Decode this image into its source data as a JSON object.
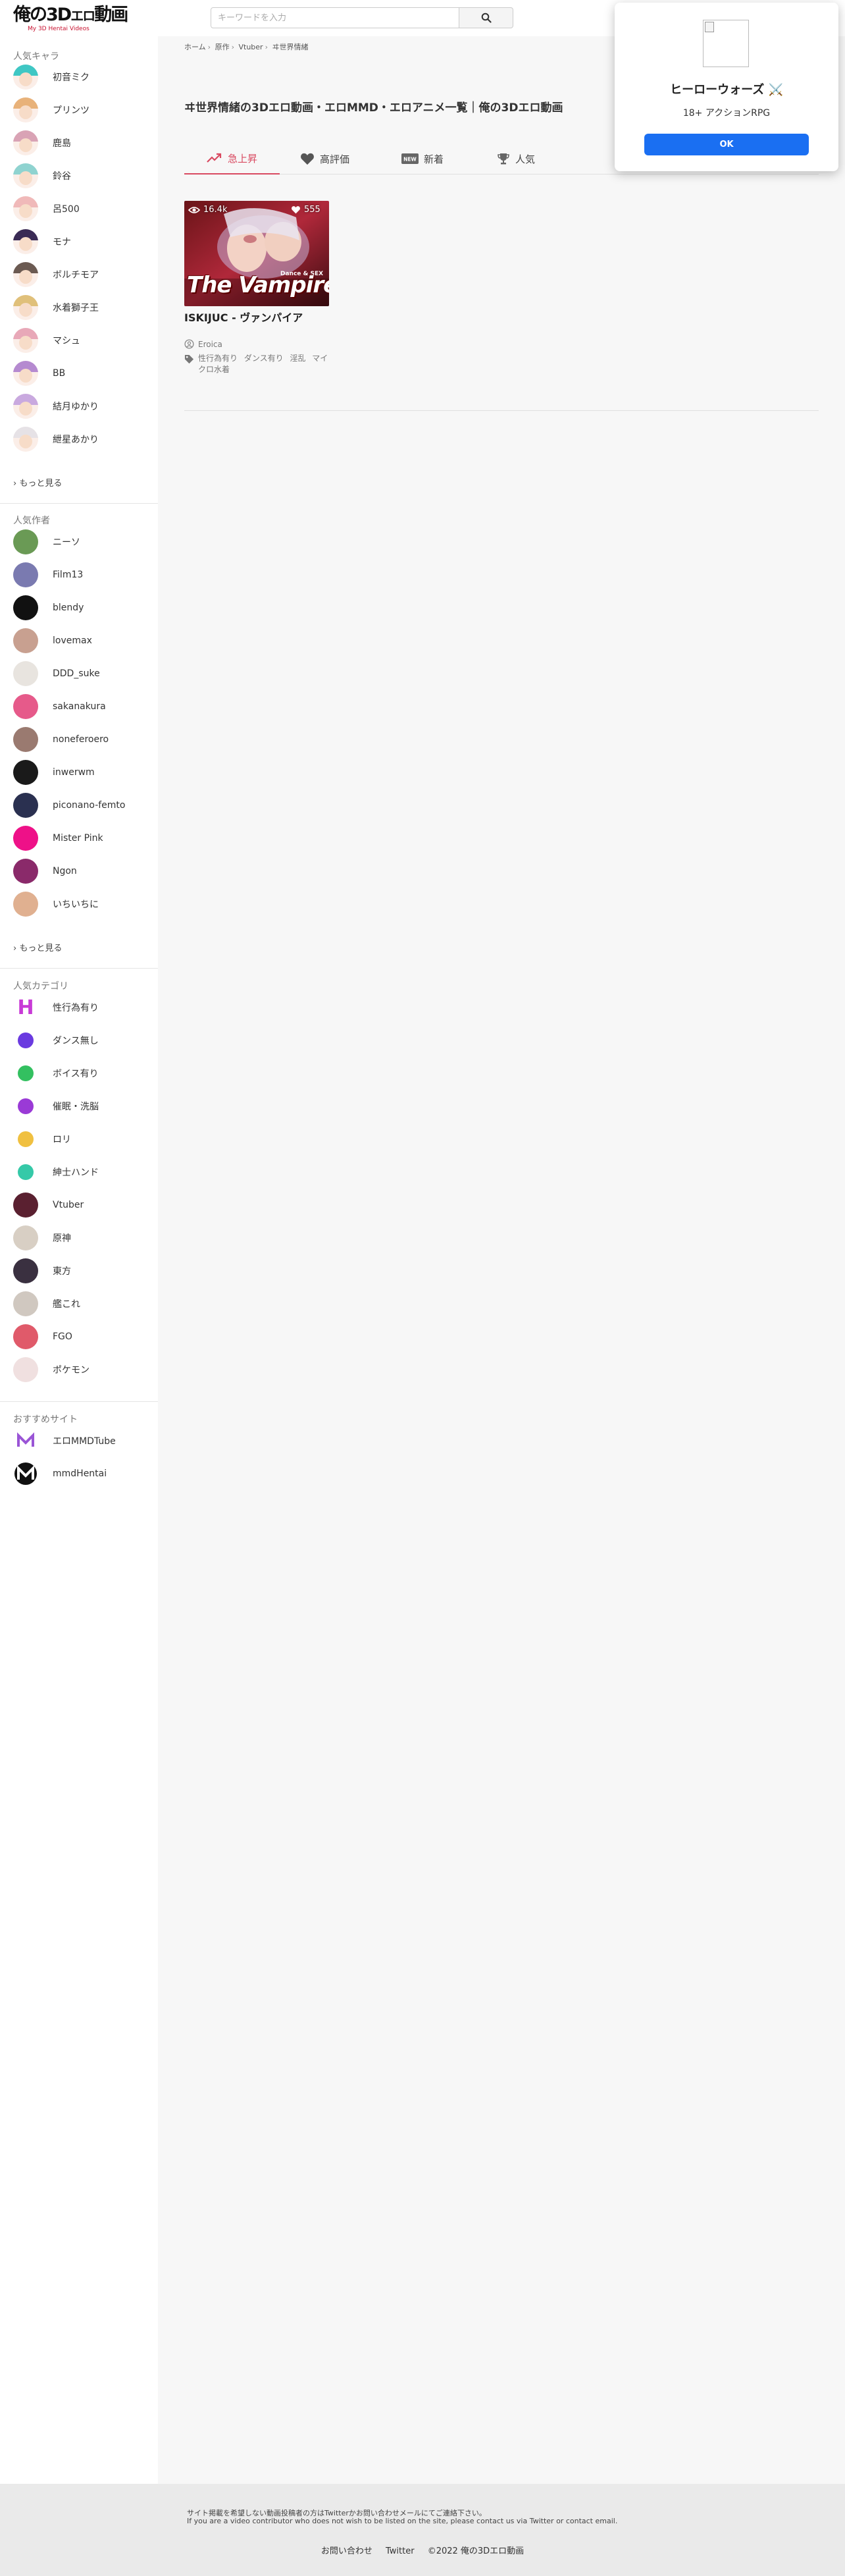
{
  "header": {
    "logo_main": "俺の3D",
    "logo_small": "エロ",
    "logo_tail": "動画",
    "logo_sub": "My 3D Hentai Videos",
    "search_placeholder": "キーワードを入力",
    "search_value": ""
  },
  "sidebar": {
    "characters_title": "人気キャラ",
    "characters": [
      {
        "label": "初音ミク",
        "hair": "#3fc7c4"
      },
      {
        "label": "プリンツ",
        "hair": "#e8b27a"
      },
      {
        "label": "鹿島",
        "hair": "#d9a3b5"
      },
      {
        "label": "鈴谷",
        "hair": "#8fd3d0"
      },
      {
        "label": "呂500",
        "hair": "#f0b9b9"
      },
      {
        "label": "モナ",
        "hair": "#3a2b55"
      },
      {
        "label": "ボルチモア",
        "hair": "#6b5a52"
      },
      {
        "label": "水着獅子王",
        "hair": "#e0c07a"
      },
      {
        "label": "マシュ",
        "hair": "#e8a8b8"
      },
      {
        "label": "BB",
        "hair": "#b58ad0"
      },
      {
        "label": "結月ゆかり",
        "hair": "#c9a9df"
      },
      {
        "label": "紲星あかり",
        "hair": "#e6e2e6"
      }
    ],
    "characters_more": "› もっと見る",
    "authors_title": "人気作者",
    "authors": [
      {
        "label": "ニーソ",
        "color": "#6a9a55"
      },
      {
        "label": "Film13",
        "color": "#7a7ab0"
      },
      {
        "label": "blendy",
        "color": "#111111"
      },
      {
        "label": "lovemax",
        "color": "#c8a090"
      },
      {
        "label": "DDD_suke",
        "color": "#e8e4df"
      },
      {
        "label": "sakanakura",
        "color": "#e65a8a"
      },
      {
        "label": "noneferoero",
        "color": "#9a7a70"
      },
      {
        "label": "inwerwm",
        "color": "#1a1a1a"
      },
      {
        "label": "piconano-femto",
        "color": "#2a3050"
      },
      {
        "label": "Mister Pink",
        "color": "#ee1188"
      },
      {
        "label": "Ngon",
        "color": "#8a2a6a"
      },
      {
        "label": "いちいちに",
        "color": "#e0b090"
      }
    ],
    "authors_more": "› もっと見る",
    "categories_title": "人気カテゴリ",
    "categories": [
      {
        "label": "性行為有り",
        "icon": "h-letter-icon",
        "color": "#c83ad6"
      },
      {
        "label": "ダンス無し",
        "icon": "dancer-icon",
        "color": "#6a3ae0"
      },
      {
        "label": "ボイス有り",
        "icon": "speaker-icon",
        "color": "#33c060"
      },
      {
        "label": "催眠・洗脳",
        "icon": "brain-icon",
        "color": "#9a3ad6"
      },
      {
        "label": "ロリ",
        "icon": "child-icon",
        "color": "#f0c040"
      },
      {
        "label": "紳士ハンド",
        "icon": "hand-icon",
        "color": "#35c9a8"
      },
      {
        "label": "Vtuber",
        "icon": "vtuber-avatar",
        "color": "#5a2030"
      },
      {
        "label": "原神",
        "icon": "genshin-avatar",
        "color": "#d8cfc4"
      },
      {
        "label": "東方",
        "icon": "touhou-avatar",
        "color": "#3a3040"
      },
      {
        "label": "艦これ",
        "icon": "kancolle-avatar",
        "color": "#d0c8c0"
      },
      {
        "label": "FGO",
        "icon": "fgo-avatar",
        "color": "#e05a6a"
      },
      {
        "label": "ポケモン",
        "icon": "pokemon-avatar",
        "color": "#f0e0e0"
      }
    ],
    "recommended_title": "おすすめサイト",
    "recommended": [
      {
        "label": "エロMMDTube",
        "icon": "m-logo-icon",
        "color": "#9a55d6"
      },
      {
        "label": "mmdHentai",
        "icon": "m-logo-dark-icon",
        "color": "#111111"
      }
    ]
  },
  "breadcrumb": [
    "ホーム",
    "原作",
    "Vtuber",
    "ヰ世界情緒"
  ],
  "page_title": "ヰ世界情緒の3Dエロ動画・エロMMD・エロアニメ一覧｜俺の3Dエロ動画",
  "tabs": [
    {
      "label": "急上昇",
      "icon": "trending-icon",
      "active": true
    },
    {
      "label": "高評価",
      "icon": "heart-icon",
      "active": false
    },
    {
      "label": "新着",
      "icon": "new-icon",
      "active": false
    },
    {
      "label": "人気",
      "icon": "trophy-icon",
      "active": false
    }
  ],
  "video": {
    "views": "16.4k",
    "likes": "555",
    "thumb_title": "The Vampire",
    "thumb_sub": "Dance & SEX",
    "title": "ISKIJUC - ヴァンパイア",
    "author": "Eroica",
    "tags": [
      "性行為有り",
      "ダンス有り",
      "淫乱",
      "マイクロ水着"
    ]
  },
  "popup": {
    "title": "ヒーローウォーズ ⚔️",
    "subtitle": "18+ アクションRPG",
    "button": "OK"
  },
  "footer": {
    "notice_ja": "サイト掲載を希望しない動画投稿者の方はTwitterかお問い合わせメールにてご連絡下さい。",
    "notice_en": "If you are a video contributor who does not wish to be listed on the site, please contact us via Twitter or contact email.",
    "contact": "お問い合わせ",
    "twitter": "Twitter",
    "copyright": "©2022 俺の3Dエロ動画"
  },
  "colors": {
    "accent": "#d94960",
    "popup_button": "#1a6ff2"
  }
}
